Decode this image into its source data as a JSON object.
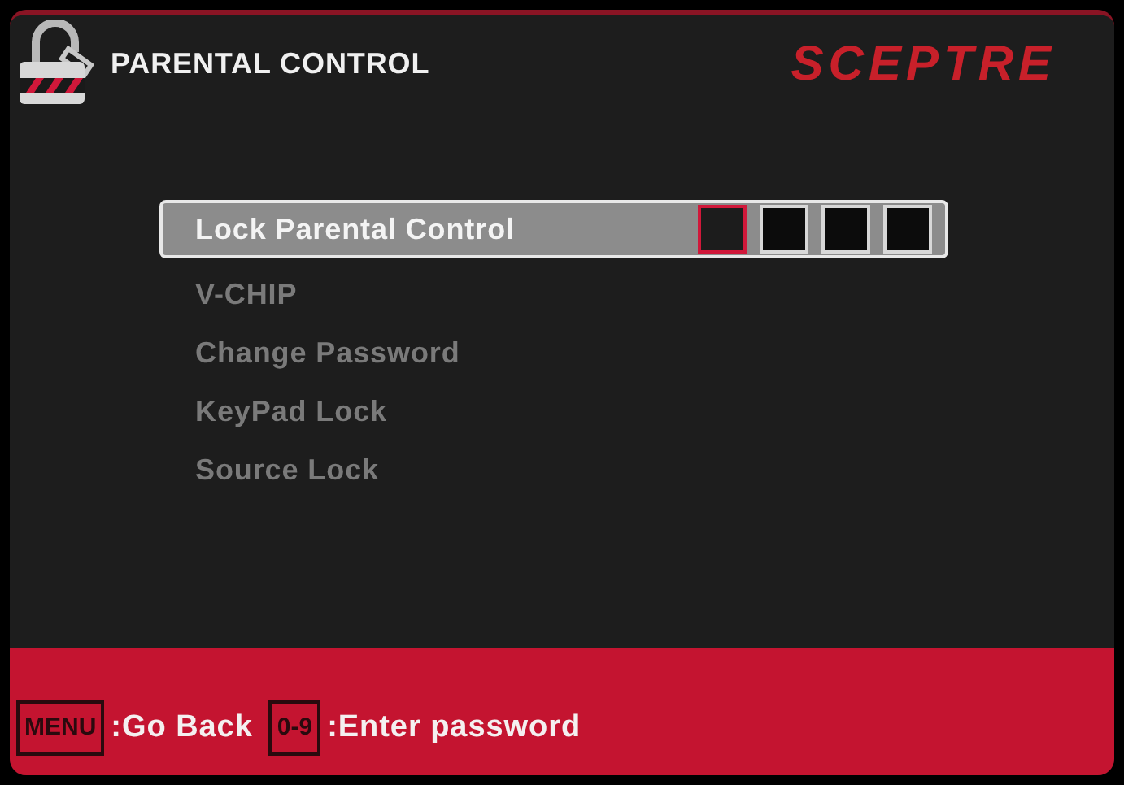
{
  "header": {
    "title": "PARENTAL CONTROL",
    "brand": "SCEPTRE"
  },
  "menu": [
    {
      "label": "Lock Parental Control",
      "selected": true,
      "pin_boxes": [
        {
          "selected": true
        },
        {
          "selected": false
        },
        {
          "selected": false
        },
        {
          "selected": false
        }
      ]
    },
    {
      "label": "V-CHIP",
      "selected": false
    },
    {
      "label": "Change Password",
      "selected": false
    },
    {
      "label": "KeyPad Lock",
      "selected": false
    },
    {
      "label": "Source Lock",
      "selected": false
    }
  ],
  "footer": [
    {
      "key": "MENU",
      "label": ":Go Back"
    },
    {
      "key": "0-9",
      "label": ":Enter password"
    }
  ]
}
